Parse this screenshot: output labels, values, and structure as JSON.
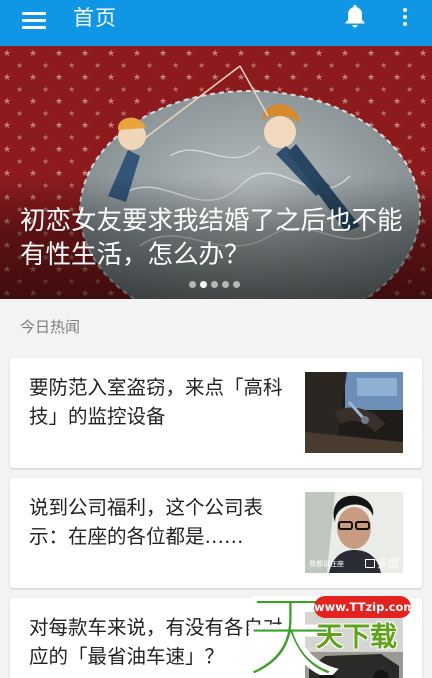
{
  "appbar": {
    "title": "首页",
    "background": "#0f97e6",
    "icons": [
      "menu-icon",
      "bell-icon",
      "more-vertical-icon"
    ]
  },
  "banner": {
    "title": "初恋女友要求我结婚了之后也不能有性生活，怎么办？",
    "slide_count": 5,
    "active_slide": 2
  },
  "section": {
    "label": "今日热闻"
  },
  "news": [
    {
      "title": "要防范入室盗窃，来点「高科技」的监控设备"
    },
    {
      "title": "说到公司福利，这个公司表示：在座的各位都是……",
      "badge": "多图",
      "thumb_caption": "我都说在座"
    },
    {
      "title": "对每款车来说，有没有各自对应的「最省油车速」？"
    }
  ],
  "watermark": {
    "url": "www.TTzip.com",
    "text": "天下载",
    "big_char": "天"
  }
}
